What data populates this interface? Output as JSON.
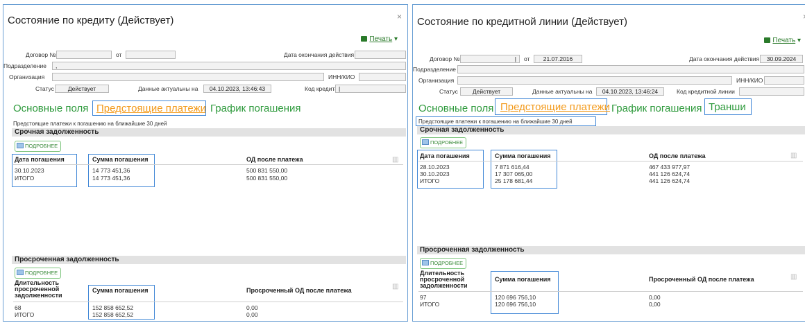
{
  "left": {
    "title": "Состояние по кредиту (Действует)",
    "close": "×",
    "print": "Печать",
    "labels": {
      "dogovor": "Договор №",
      "ot": "от",
      "date_end": "Дата окончания действия",
      "podrazd": "Подразделение",
      "org": "Организация",
      "inn": "ИНН/КИО",
      "status": "Статус",
      "actual": "Данные актуальны на",
      "code": "Код кредита"
    },
    "values": {
      "podrazd": ",",
      "status": "Действует",
      "actual": "04.10.2023, 13:46:43",
      "code": "|"
    },
    "tabs": [
      "Основные поля",
      "Предстоящие платежи",
      "График погашения"
    ],
    "note": "Предстоящие платежи к погашению на ближайшие 30 дней",
    "urgent_title": "Срочная задолженность",
    "more": "ПОДРОБНЕЕ",
    "urgent_headers": [
      "Дата погашения",
      "Сумма погашения",
      "ОД после платежа"
    ],
    "urgent_rows": [
      [
        "30.10.2023",
        "14 773 451,36",
        "500 831 550,00"
      ],
      [
        "ИТОГО",
        "14 773 451,36",
        "500 831 550,00"
      ]
    ],
    "overdue_title": "Просроченная задолженность",
    "overdue_headers": [
      "Длительность просроченной задолженности",
      "Сумма погашения",
      "Просроченный ОД после платежа"
    ],
    "overdue_rows": [
      [
        "68",
        "152 858 652,52",
        "0,00"
      ],
      [
        "ИТОГО",
        "152 858 652,52",
        "0,00"
      ]
    ]
  },
  "right": {
    "title": "Состояние по кредитной линии (Действует)",
    "close": "×",
    "print": "Печать",
    "labels": {
      "dogovor": "Договор №",
      "ot": "от",
      "date_end": "Дата окончания действия",
      "podrazd": "Подразделение",
      "org": "Организация",
      "inn": "ИНН/КИО",
      "status": "Статус",
      "actual": "Данные актуальны на",
      "code": "Код кредитной линии"
    },
    "values": {
      "dogovor_tail": "|",
      "ot": "21.07.2016",
      "date_end": "30.09.2024",
      "status": "Действует",
      "actual": "04.10.2023, 13:46:24"
    },
    "tabs": [
      "Основные поля",
      "Предстоящие платежи",
      "График погашения",
      "Транши"
    ],
    "note": "Предстоящие платежи к погашению на ближайшие 30 дней",
    "urgent_title": "Срочная задолженность",
    "more": "ПОДРОБНЕЕ",
    "urgent_headers": [
      "Дата погашения",
      "Сумма погашения",
      "ОД после платежа"
    ],
    "urgent_rows": [
      [
        "28.10.2023",
        "7 871 616,44",
        "467 433 977,97"
      ],
      [
        "30.10.2023",
        "17 307 065,00",
        "441 126 624,74"
      ],
      [
        "ИТОГО",
        "25 178 681,44",
        "441 126 624,74"
      ]
    ],
    "overdue_title": "Просроченная задолженность",
    "overdue_headers": [
      "Длительность просроченной задолженности",
      "Сумма погашения",
      "Просроченный ОД после платежа"
    ],
    "overdue_rows": [
      [
        "97",
        "120 696 756,10",
        "0,00"
      ],
      [
        "ИТОГО",
        "120 696 756,10",
        "0,00"
      ]
    ]
  },
  "icons": {
    "print": "printer-icon",
    "more": "details-icon",
    "columns": "columns-icon"
  },
  "colors": {
    "tab_green": "#2e9a3c",
    "tab_active": "#f39a1b",
    "highlight": "#3f86d6"
  }
}
